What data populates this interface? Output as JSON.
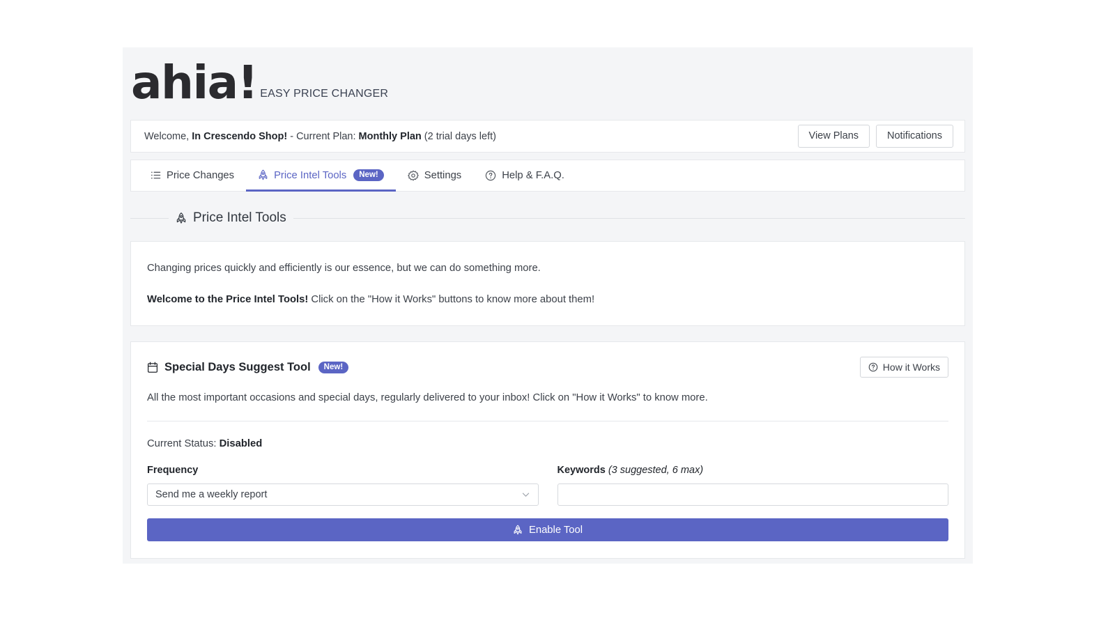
{
  "brand": {
    "logo": "ahia!",
    "tagline": "EASY PRICE CHANGER"
  },
  "plan_bar": {
    "welcome_prefix": "Welcome, ",
    "shop_name": "In Crescendo Shop!",
    "plan_prefix": " - Current Plan: ",
    "plan_name": "Monthly Plan",
    "trial_suffix": " (2 trial days left)",
    "view_plans_label": "View Plans",
    "notifications_label": "Notifications"
  },
  "tabs": [
    {
      "label": "Price Changes",
      "icon": "list-icon",
      "active": false,
      "badge": ""
    },
    {
      "label": "Price Intel Tools",
      "icon": "rocket-icon",
      "active": true,
      "badge": "New!"
    },
    {
      "label": "Settings",
      "icon": "gear-icon",
      "active": false,
      "badge": ""
    },
    {
      "label": "Help & F.A.Q.",
      "icon": "question-circle-icon",
      "active": false,
      "badge": ""
    }
  ],
  "section": {
    "title": "Price Intel Tools",
    "icon": "rocket-icon"
  },
  "intro": {
    "line1": "Changing prices quickly and efficiently is our essence, but we can do something more.",
    "line2_bold": "Welcome to the Price Intel Tools!",
    "line2_rest": " Click on the \"How it Works\" buttons to know more about them!"
  },
  "tool": {
    "icon": "calendar-icon",
    "title": "Special Days Suggest Tool",
    "badge": "New!",
    "how_it_works_label": "How it Works",
    "description": "All the most important occasions and special days, regularly delivered to your inbox! Click on \"How it Works\" to know more.",
    "status_label": "Current Status: ",
    "status_value": "Disabled",
    "frequency_label": "Frequency",
    "frequency_value": "Send me a weekly report",
    "frequency_options": [
      "Send me a weekly report"
    ],
    "keywords_label": "Keywords ",
    "keywords_hint": "(3 suggested, 6 max)",
    "keywords_value": "",
    "keywords_placeholder": "",
    "enable_label": "Enable Tool",
    "enable_icon": "rocket-icon"
  },
  "colors": {
    "accent": "#5b65c4",
    "page_bg": "#f4f5f7",
    "card_bg": "#ffffff",
    "text": "#3c4149"
  }
}
